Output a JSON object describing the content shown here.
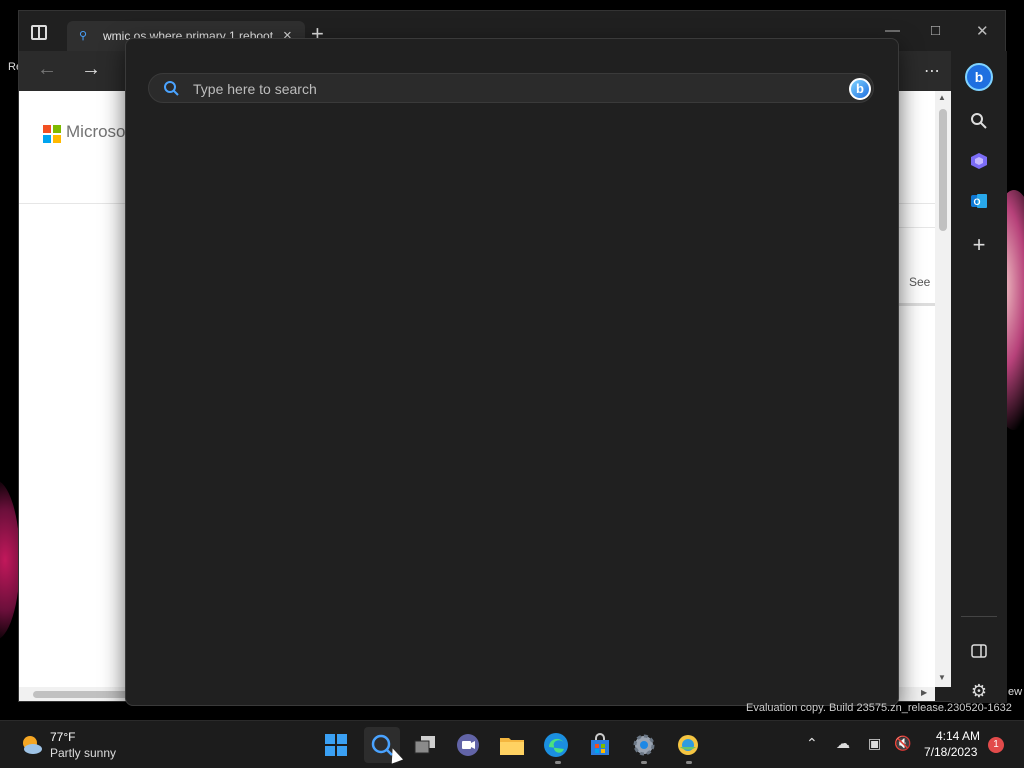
{
  "desktop": {
    "left_fragment": "Re",
    "right_fragment": "ew",
    "watermark": "Evaluation copy. Build 23575.zn_release.230520-1632"
  },
  "browser": {
    "tab_title": "wmic os where primary 1 reboot",
    "page": {
      "brand": "Microsoft",
      "see_link": "See"
    }
  },
  "search": {
    "placeholder": "Type here to search"
  },
  "taskbar": {
    "weather_temp": "77°F",
    "weather_condition": "Partly sunny",
    "time": "4:14 AM",
    "date": "7/18/2023",
    "notification_count": "1",
    "apps": [
      "start-button",
      "search-button",
      "task-view-button",
      "teams-chat-button",
      "file-explorer-button",
      "edge-button",
      "store-button",
      "settings-button",
      "app-button"
    ]
  },
  "colors": {
    "accent": "#4aa3ff",
    "panel_bg": "#202020",
    "badge_red": "#e24b4b"
  }
}
